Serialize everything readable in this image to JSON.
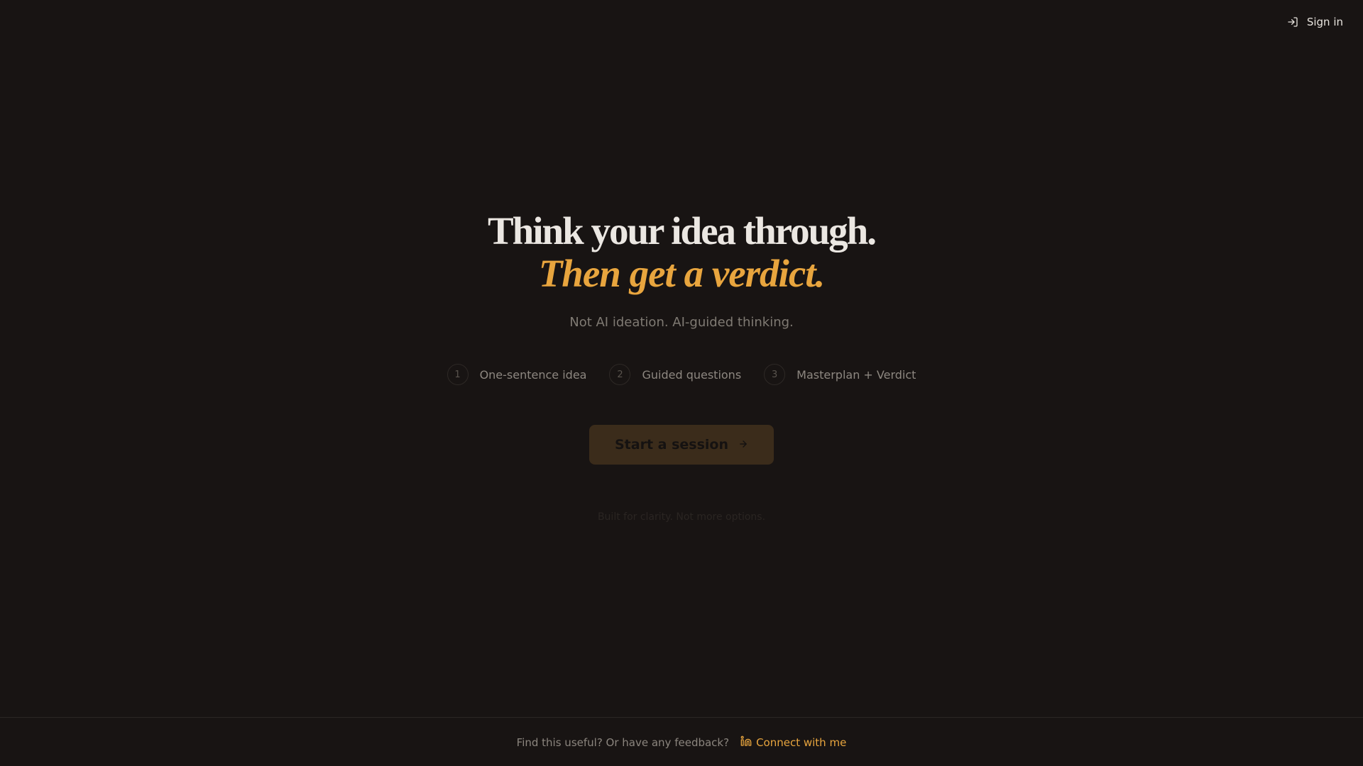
{
  "header": {
    "signin_label": "Sign in",
    "signin_icon": "log-in-icon"
  },
  "hero": {
    "headline_line1": "Think your idea through.",
    "headline_line2": "Then get a verdict.",
    "subtitle": "Not AI ideation. AI-guided thinking."
  },
  "steps": [
    {
      "number": "1",
      "label": "One-sentence idea"
    },
    {
      "number": "2",
      "label": "Guided questions"
    },
    {
      "number": "3",
      "label": "Masterplan + Verdict"
    }
  ],
  "cta": {
    "label": "Start a session",
    "icon": "arrow-right-icon"
  },
  "tagline": "Built for clarity. Not more options.",
  "footer": {
    "text": "Find this useful? Or have any feedback?",
    "link_label": "Connect with me",
    "link_icon": "linkedin-icon"
  },
  "colors": {
    "background": "#181413",
    "accent": "#e8a53e",
    "heading": "#ebe7e2",
    "muted": "#7f7a73"
  }
}
